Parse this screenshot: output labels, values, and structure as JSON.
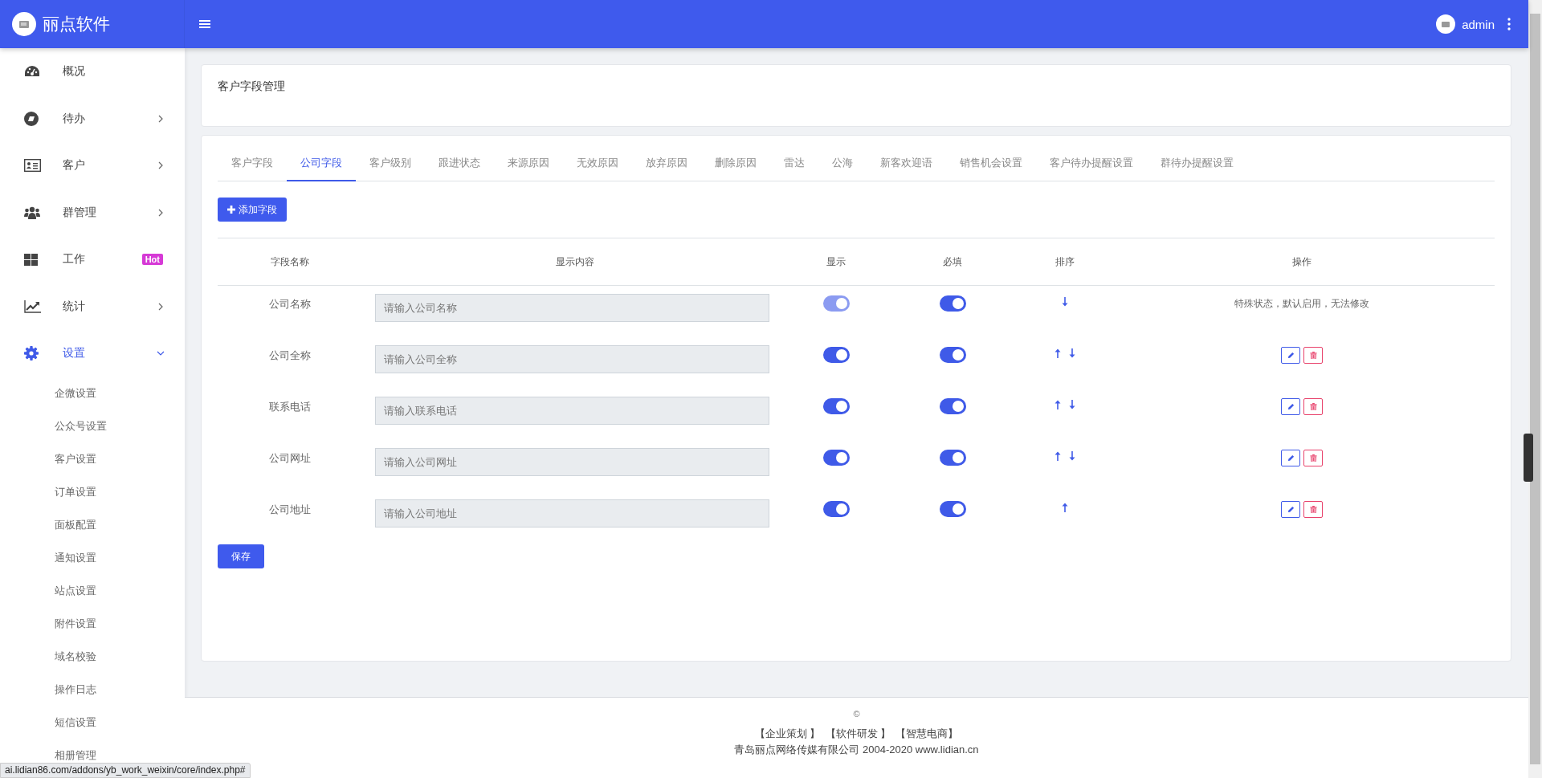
{
  "brand": {
    "name": "丽点软件"
  },
  "header": {
    "user": "admin"
  },
  "sidebar": {
    "items": [
      {
        "label": "概况",
        "selected": false
      },
      {
        "label": "待办",
        "selected": false,
        "expanded": false
      },
      {
        "label": "客户",
        "selected": false,
        "expanded": false
      },
      {
        "label": "群管理",
        "selected": false,
        "expanded": false
      },
      {
        "label": "工作",
        "selected": false,
        "badge": "Hot"
      },
      {
        "label": "统计",
        "selected": false,
        "expanded": false
      },
      {
        "label": "设置",
        "selected": true,
        "expanded": true,
        "children": [
          {
            "label": "企微设置"
          },
          {
            "label": "公众号设置"
          },
          {
            "label": "客户设置"
          },
          {
            "label": "订单设置"
          },
          {
            "label": "面板配置"
          },
          {
            "label": "通知设置"
          },
          {
            "label": "站点设置"
          },
          {
            "label": "附件设置"
          },
          {
            "label": "域名校验"
          },
          {
            "label": "操作日志"
          },
          {
            "label": "短信设置"
          },
          {
            "label": "相册管理"
          }
        ]
      }
    ]
  },
  "page_title": "客户字段管理",
  "tabs": [
    {
      "label": "客户字段",
      "selected": false
    },
    {
      "label": "公司字段",
      "selected": true
    },
    {
      "label": "客户级别",
      "selected": false
    },
    {
      "label": "跟进状态",
      "selected": false
    },
    {
      "label": "来源原因",
      "selected": false
    },
    {
      "label": "无效原因",
      "selected": false
    },
    {
      "label": "放弃原因",
      "selected": false
    },
    {
      "label": "删除原因",
      "selected": false
    },
    {
      "label": "雷达",
      "selected": false
    },
    {
      "label": "公海",
      "selected": false
    },
    {
      "label": "新客欢迎语",
      "selected": false
    },
    {
      "label": "销售机会设置",
      "selected": false
    },
    {
      "label": "客户待办提醒设置",
      "selected": false
    },
    {
      "label": "群待办提醒设置",
      "selected": false
    }
  ],
  "add_button": "添加字段",
  "table": {
    "columns": [
      "字段名称",
      "显示内容",
      "显示",
      "必填",
      "排序",
      "操作"
    ],
    "rows": [
      {
        "name": "公司名称",
        "placeholder": "请输入公司名称",
        "show": {
          "on": true,
          "disabled": true
        },
        "required": {
          "on": true,
          "disabled": false
        },
        "move_up": false,
        "move_down": true,
        "kind": "note",
        "note": "特殊状态，默认启用，无法修改"
      },
      {
        "name": "公司全称",
        "placeholder": "请输入公司全称",
        "show": {
          "on": true,
          "disabled": false
        },
        "required": {
          "on": true,
          "disabled": false
        },
        "move_up": true,
        "move_down": true,
        "kind": "actions"
      },
      {
        "name": "联系电话",
        "placeholder": "请输入联系电话",
        "show": {
          "on": true,
          "disabled": false
        },
        "required": {
          "on": true,
          "disabled": false
        },
        "move_up": true,
        "move_down": true,
        "kind": "actions"
      },
      {
        "name": "公司网址",
        "placeholder": "请输入公司网址",
        "show": {
          "on": true,
          "disabled": false
        },
        "required": {
          "on": true,
          "disabled": false
        },
        "move_up": true,
        "move_down": true,
        "kind": "actions"
      },
      {
        "name": "公司地址",
        "placeholder": "请输入公司地址",
        "show": {
          "on": true,
          "disabled": false
        },
        "required": {
          "on": true,
          "disabled": false
        },
        "move_up": true,
        "move_down": false,
        "kind": "actions"
      }
    ]
  },
  "save_button": "保存",
  "footer": {
    "mark": "©",
    "links": [
      "【企业策划 】",
      "【软件研发 】",
      "【智慧电商】"
    ],
    "copyright": "青岛丽点网络传媒有限公司 2004-2020 www.lidian.cn"
  },
  "status_url": "ai.lidian86.com/addons/yb_work_weixin/core/index.php#"
}
